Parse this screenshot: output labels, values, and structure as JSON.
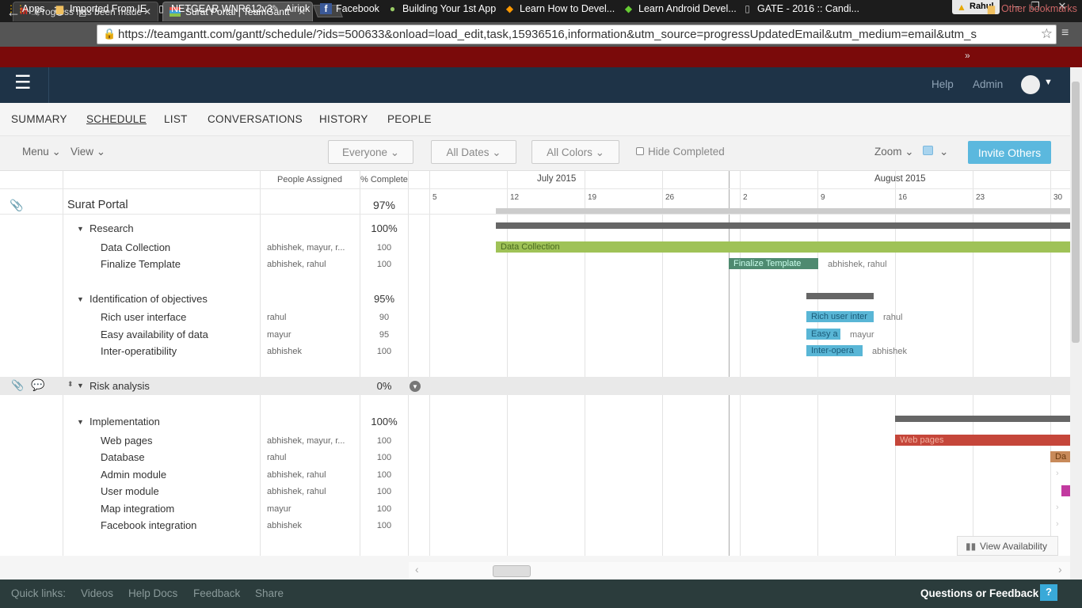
{
  "browser": {
    "tabs": [
      {
        "title": "Progress has been made",
        "active": false
      },
      {
        "title": "Surat Portal | TeamGantt",
        "active": true
      }
    ],
    "profile": "Rahul",
    "url": "https://teamgantt.com/gantt/schedule/?ids=500633&onload=load_edit,task,15936516,information&utm_source=progressUpdatedEmail&utm_medium=email&utm_s",
    "bookmarks": [
      "Apps",
      "Imported From IE",
      "NETGEAR WNR612v3",
      "Airink",
      "Facebook",
      "Building Your 1st App",
      "Learn How to Devel...",
      "Learn Android Devel...",
      "GATE - 2016 :: Candi..."
    ],
    "other_bookmarks": "Other bookmarks"
  },
  "header": {
    "help": "Help",
    "admin": "Admin"
  },
  "nav_tabs": [
    "SUMMARY",
    "SCHEDULE",
    "LIST",
    "CONVERSATIONS",
    "HISTORY",
    "PEOPLE"
  ],
  "toolbar": {
    "menu": "Menu",
    "view": "View",
    "everyone": "Everyone",
    "all_dates": "All Dates",
    "all_colors": "All Colors",
    "hide_completed": "Hide Completed",
    "zoom": "Zoom",
    "invite": "Invite Others"
  },
  "columns": {
    "people": "People Assigned",
    "pct": "% Complete"
  },
  "months": [
    "July 2015",
    "August 2015"
  ],
  "days": [
    "5",
    "12",
    "19",
    "26",
    "2",
    "9",
    "16",
    "23",
    "30"
  ],
  "project": {
    "name": "Surat Portal",
    "pct": "97%"
  },
  "groups": [
    {
      "name": "Research",
      "pct": "100%",
      "tasks": [
        {
          "name": "Data Collection",
          "people": "abhishek, mayur, r...",
          "pct": "100",
          "bar": "Data Collection",
          "bar_label": ""
        },
        {
          "name": "Finalize Template",
          "people": "abhishek, rahul",
          "pct": "100",
          "bar": "Finalize Template",
          "bar_label": "abhishek, rahul"
        }
      ]
    },
    {
      "name": "Identification of objectives",
      "pct": "95%",
      "tasks": [
        {
          "name": "Rich user interface",
          "people": "rahul",
          "pct": "90",
          "bar": "Rich user inter",
          "bar_label": "rahul"
        },
        {
          "name": "Easy availability of data",
          "people": "mayur",
          "pct": "95",
          "bar": "Easy a",
          "bar_label": "mayur"
        },
        {
          "name": "Inter-operatibility",
          "people": "abhishek",
          "pct": "100",
          "bar": "Inter-opera",
          "bar_label": "abhishek"
        }
      ]
    },
    {
      "name": "Risk analysis",
      "pct": "0%",
      "tasks": []
    },
    {
      "name": "Implementation",
      "pct": "100%",
      "tasks": [
        {
          "name": "Web pages",
          "people": "abhishek, mayur, r...",
          "pct": "100",
          "bar": "Web pages",
          "bar_label": ""
        },
        {
          "name": "Database",
          "people": "rahul",
          "pct": "100",
          "bar": "Da",
          "bar_label": ""
        },
        {
          "name": "Admin module",
          "people": "abhishek, rahul",
          "pct": "100",
          "bar": "",
          "bar_label": ""
        },
        {
          "name": "User module",
          "people": "abhishek, rahul",
          "pct": "100",
          "bar": "",
          "bar_label": ""
        },
        {
          "name": "Map integratiom",
          "people": "mayur",
          "pct": "100",
          "bar": "",
          "bar_label": ""
        },
        {
          "name": "Facebook integration",
          "people": "abhishek",
          "pct": "100",
          "bar": "",
          "bar_label": ""
        }
      ]
    }
  ],
  "view_availability": "View Availability",
  "footer": {
    "quick_links": "Quick links:",
    "links": [
      "Videos",
      "Help Docs",
      "Feedback",
      "Share"
    ],
    "questions": "Questions or Feedback",
    "q_icon": "?"
  },
  "colors": {
    "data_collection": "#9fc257",
    "finalize_template": "#4e8a70",
    "objectives": "#59b6d6",
    "web_pages": "#c5463a",
    "database": "#c88a5a",
    "user_module": "#c23aa0"
  }
}
